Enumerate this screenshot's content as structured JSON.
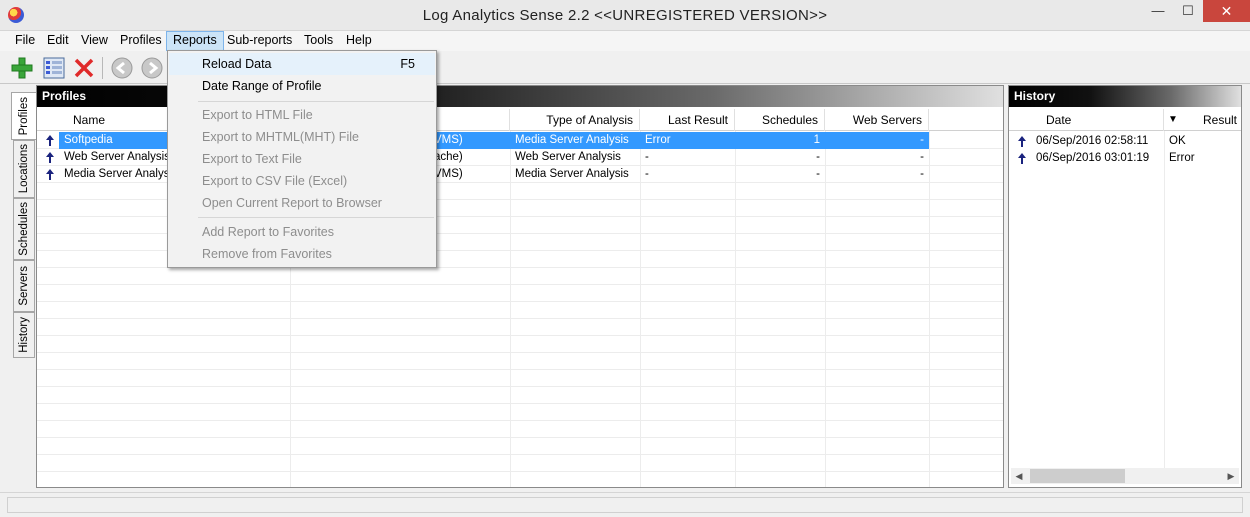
{
  "window": {
    "title": "Log Analytics Sense 2.2 <<UNREGISTERED VERSION>>",
    "minimize": "—",
    "maximize": "☐",
    "close": "✕"
  },
  "menubar": [
    "File",
    "Edit",
    "View",
    "Profiles",
    "Reports",
    "Sub-reports",
    "Tools",
    "Help"
  ],
  "vtabs": [
    "Profiles",
    "Locations",
    "Schedules",
    "Servers",
    "History"
  ],
  "profiles": {
    "title": "Profiles",
    "columns": [
      "Name",
      "Type of Analysis",
      "Last Result",
      "Schedules",
      "Web Servers"
    ],
    "rows": [
      {
        "name": "Softpedia",
        "server": "VMS)",
        "type": "Media Server Analysis",
        "last_result": "Error",
        "schedules": "1",
        "web_servers": "-"
      },
      {
        "name": "Web Server Analysis S",
        "server": "ache)",
        "type": "Web Server Analysis",
        "last_result": "-",
        "schedules": "-",
        "web_servers": "-"
      },
      {
        "name": "Media Server Analysis",
        "server": "VMS)",
        "type": "Media Server Analysis",
        "last_result": "-",
        "schedules": "-",
        "web_servers": "-"
      }
    ]
  },
  "reports_menu": {
    "reload": "Reload Data",
    "reload_shortcut": "F5",
    "date_range": "Date Range of Profile",
    "export_html": "Export to HTML File",
    "export_mhtml": "Export to MHTML(MHT) File",
    "export_text": "Export to Text File",
    "export_csv": "Export to CSV File (Excel)",
    "open_browser": "Open Current Report to Browser",
    "add_fav": "Add Report to Favorites",
    "remove_fav": "Remove from Favorites"
  },
  "history": {
    "title": "History",
    "columns": [
      "Date",
      "Result"
    ],
    "sort_glyph": "▼",
    "rows": [
      {
        "date": "06/Sep/2016 02:58:11",
        "result": "OK"
      },
      {
        "date": "06/Sep/2016 03:01:19",
        "result": "Error"
      }
    ],
    "scroll_left": "◀",
    "scroll_right": "▶"
  },
  "colors": {
    "selection": "#3399ff",
    "menu_highlight": "#cce4f7",
    "close_button": "#c9463d",
    "add_icon": "#3aa53a",
    "delete_icon": "#e02a2a"
  },
  "icons": [
    "app-icon",
    "add-icon",
    "list-icon",
    "delete-icon",
    "back-icon",
    "forward-icon",
    "row-arrow-icon"
  ]
}
